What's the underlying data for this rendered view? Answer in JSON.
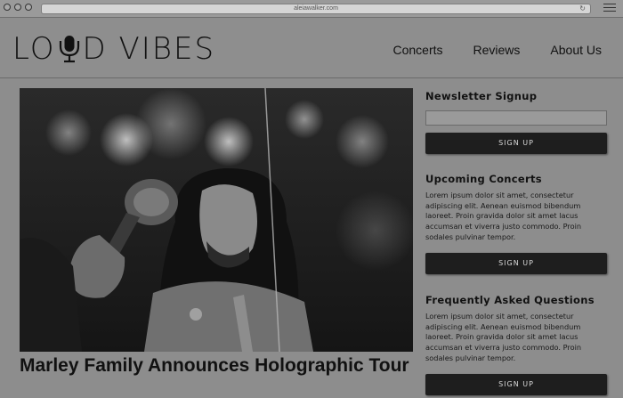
{
  "browser": {
    "url": "aleiawalker.com"
  },
  "header": {
    "logo_text_left": "LO",
    "logo_text_right": "D VIBES",
    "nav": [
      {
        "label": "Concerts"
      },
      {
        "label": "Reviews"
      },
      {
        "label": "About Us"
      }
    ]
  },
  "article": {
    "title": "Marley Family Announces Holographic Tour"
  },
  "sidebar": {
    "newsletter": {
      "heading": "Newsletter Signup",
      "email_value": "",
      "button_label": "SIGN UP"
    },
    "concerts": {
      "heading": "Upcoming Concerts",
      "body": "Lorem ipsum dolor sit amet, consectetur adipiscing elit. Aenean euismod bibendum laoreet. Proin gravida dolor sit amet lacus accumsan et viverra justo commodo. Proin sodales pulvinar tempor.",
      "button_label": "SIGN UP"
    },
    "faq": {
      "heading": "Frequently Asked Questions",
      "body": "Lorem ipsum dolor sit amet, consectetur adipiscing elit. Aenean euismod bibendum laoreet. Proin gravida dolor sit amet lacus accumsan et viverra justo commodo. Proin sodales pulvinar tempor.",
      "button_label": "SIGN UP"
    }
  },
  "colors": {
    "page_bg": "#8d8d8d",
    "button_bg": "#1e1e1e",
    "text": "#111111"
  }
}
